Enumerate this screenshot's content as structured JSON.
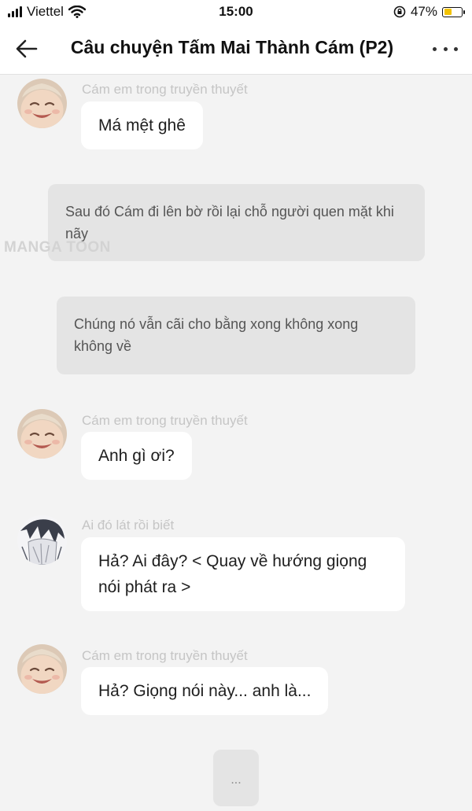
{
  "status_bar": {
    "carrier": "Viettel",
    "time": "15:00",
    "battery": "47%",
    "battery_level": 0.47,
    "colors": {
      "battery_fill": "#f2c200"
    }
  },
  "header": {
    "title": "Câu chuyện Tấm Mai Thành Cám (P2)",
    "icons": {
      "back": "back-arrow-icon",
      "more": "more-options-icon"
    }
  },
  "watermark": "MANGA TOON",
  "messages": [
    {
      "type": "character",
      "name": "Cám em trong truyền thuyết",
      "text": "Má mệt ghê",
      "avatar": "laughing-child-avatar"
    },
    {
      "type": "narration",
      "text": "Sau đó Cám đi lên bờ rồi lại chỗ người quen mặt khi nãy"
    },
    {
      "type": "narration",
      "text": "Chúng nó vẫn cãi cho bằng xong không xong không về"
    },
    {
      "type": "character",
      "name": "Cám em trong truyền thuyết",
      "text": "Anh gì ơi?",
      "avatar": "laughing-child-avatar"
    },
    {
      "type": "character",
      "name": "Ai đó lát rồi biết",
      "text": "Hả? Ai đây? < Quay về hướng giọng nói phát ra >",
      "avatar": "anime-character-avatar"
    },
    {
      "type": "character",
      "name": "Cám em trong truyền thuyết",
      "text": "Hả? Giọng nói này... anh là...",
      "avatar": "laughing-child-avatar"
    }
  ],
  "typing_indicator": "..."
}
